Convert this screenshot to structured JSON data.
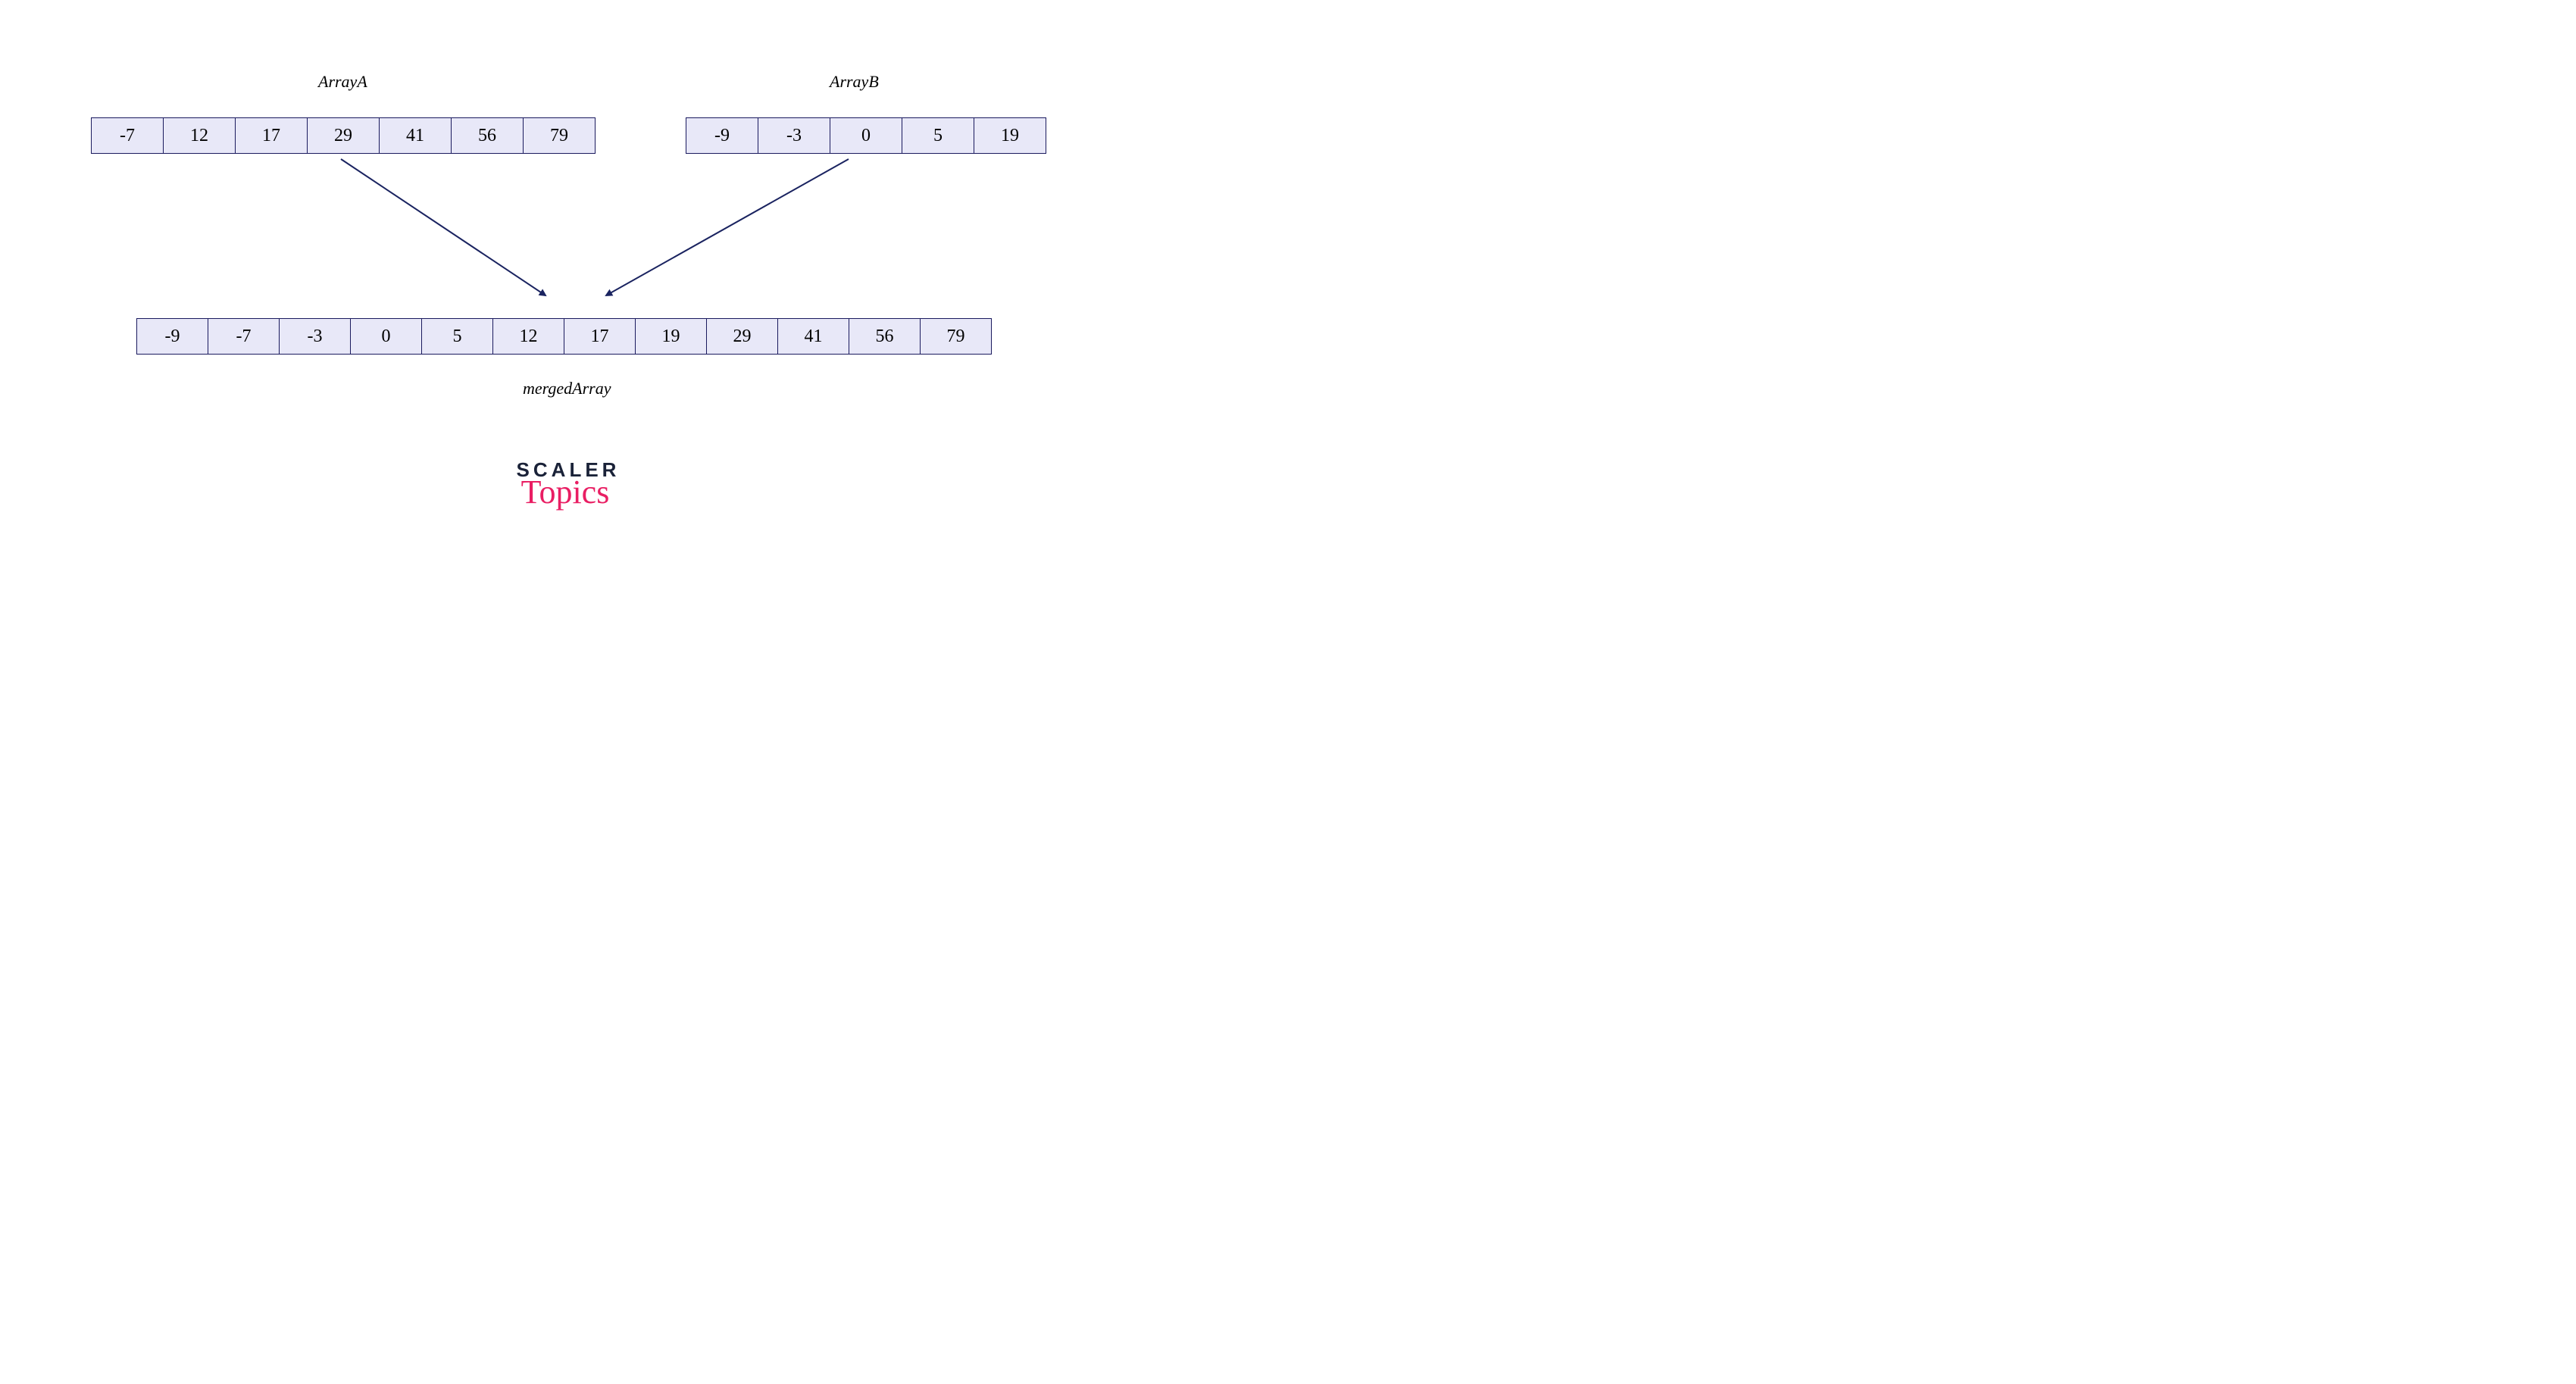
{
  "arrayA": {
    "label": "ArrayA",
    "values": [
      -7,
      12,
      17,
      29,
      41,
      56,
      79
    ]
  },
  "arrayB": {
    "label": "ArrayB",
    "values": [
      -9,
      -3,
      0,
      5,
      19
    ]
  },
  "merged": {
    "label": "mergedArray",
    "values": [
      -9,
      -7,
      -3,
      0,
      5,
      12,
      17,
      19,
      29,
      41,
      56,
      79
    ]
  },
  "logo": {
    "line1": "SCALER",
    "line2": "Topics"
  },
  "colors": {
    "cellBg": "#e8e8f8",
    "cellBorder": "#1a1a5e",
    "arrow": "#1a2360",
    "logoDark": "#1a2238",
    "logoPink": "#e91e63"
  }
}
